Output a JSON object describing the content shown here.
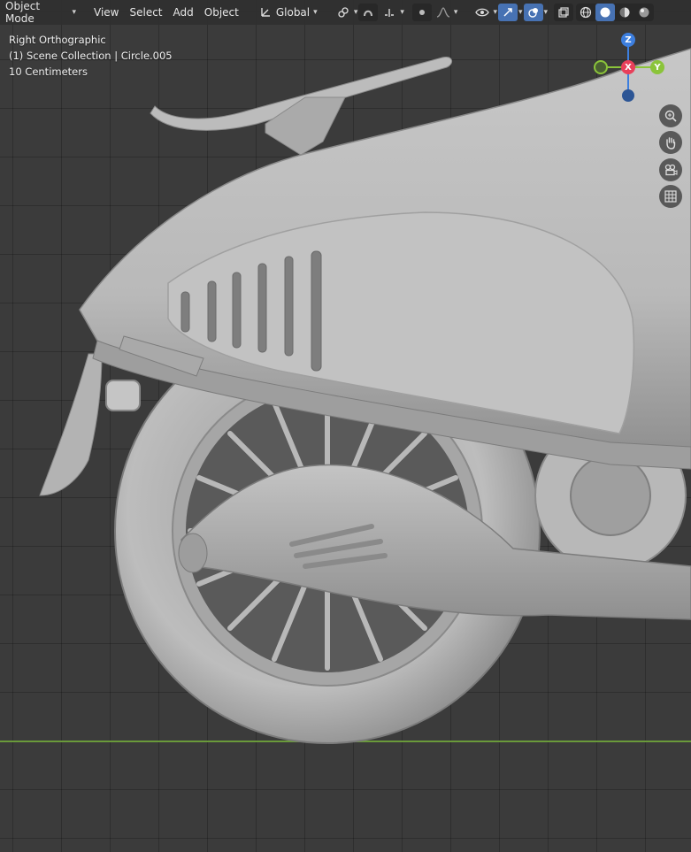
{
  "header": {
    "mode": "Object Mode",
    "menus": [
      "View",
      "Select",
      "Add",
      "Object"
    ],
    "orientation": "Global"
  },
  "overlay": {
    "view_name": "Right Orthographic",
    "collection": "(1) Scene Collection | Circle.005",
    "scale": "10 Centimeters"
  },
  "gizmo": {
    "z_label": "Z",
    "x_label": "X",
    "y_label": "Y",
    "colors": {
      "x": "#e8405a",
      "y": "#8bc43a",
      "z": "#3d7fdf"
    }
  },
  "icons": [
    "transform-orientation-icon",
    "snap-icon",
    "proportional-edit-icon",
    "visibility-icon",
    "gizmo-icon",
    "overlay-icon",
    "xray-icon",
    "wireframe-shading-icon",
    "solid-shading-icon",
    "material-shading-icon",
    "rendered-shading-icon",
    "zoom-icon",
    "pan-hand-icon",
    "camera-icon",
    "grid-icon"
  ],
  "colors": {
    "accent": "#4772b3",
    "ground_line": "#6a9a3a",
    "model": "#c9c9c9"
  }
}
